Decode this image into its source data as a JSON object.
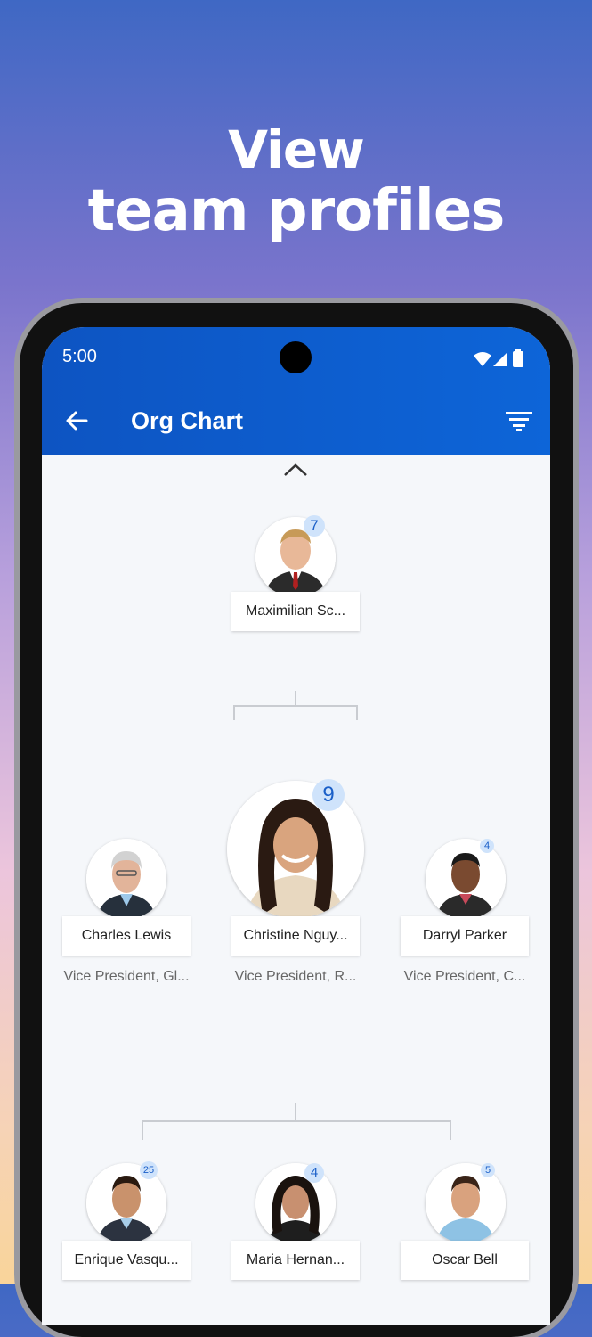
{
  "promo": {
    "line1": "View",
    "line2": "team profiles"
  },
  "status_bar": {
    "time": "5:00"
  },
  "app_bar": {
    "title": "Org Chart",
    "back_icon": "arrow-left-icon",
    "filter_icon": "filter-icon"
  },
  "colors": {
    "appbar": "#0d5fd0",
    "badge_bg": "#cfe3fb",
    "badge_text": "#1a5fc8"
  },
  "manager": {
    "name": "Maximilian Sc...",
    "reports": "7"
  },
  "level2": [
    {
      "name": "Charles Lewis",
      "title": "Vice President, Gl...",
      "reports": ""
    },
    {
      "name": "Christine Nguy...",
      "title": "Vice President, R...",
      "reports": "9"
    },
    {
      "name": "Darryl Parker",
      "title": "Vice President, C...",
      "reports": "4"
    }
  ],
  "level3": [
    {
      "name": "Enrique Vasqu...",
      "reports": "25"
    },
    {
      "name": "Maria Hernan...",
      "reports": "4"
    },
    {
      "name": "Oscar Bell",
      "reports": "5"
    }
  ]
}
